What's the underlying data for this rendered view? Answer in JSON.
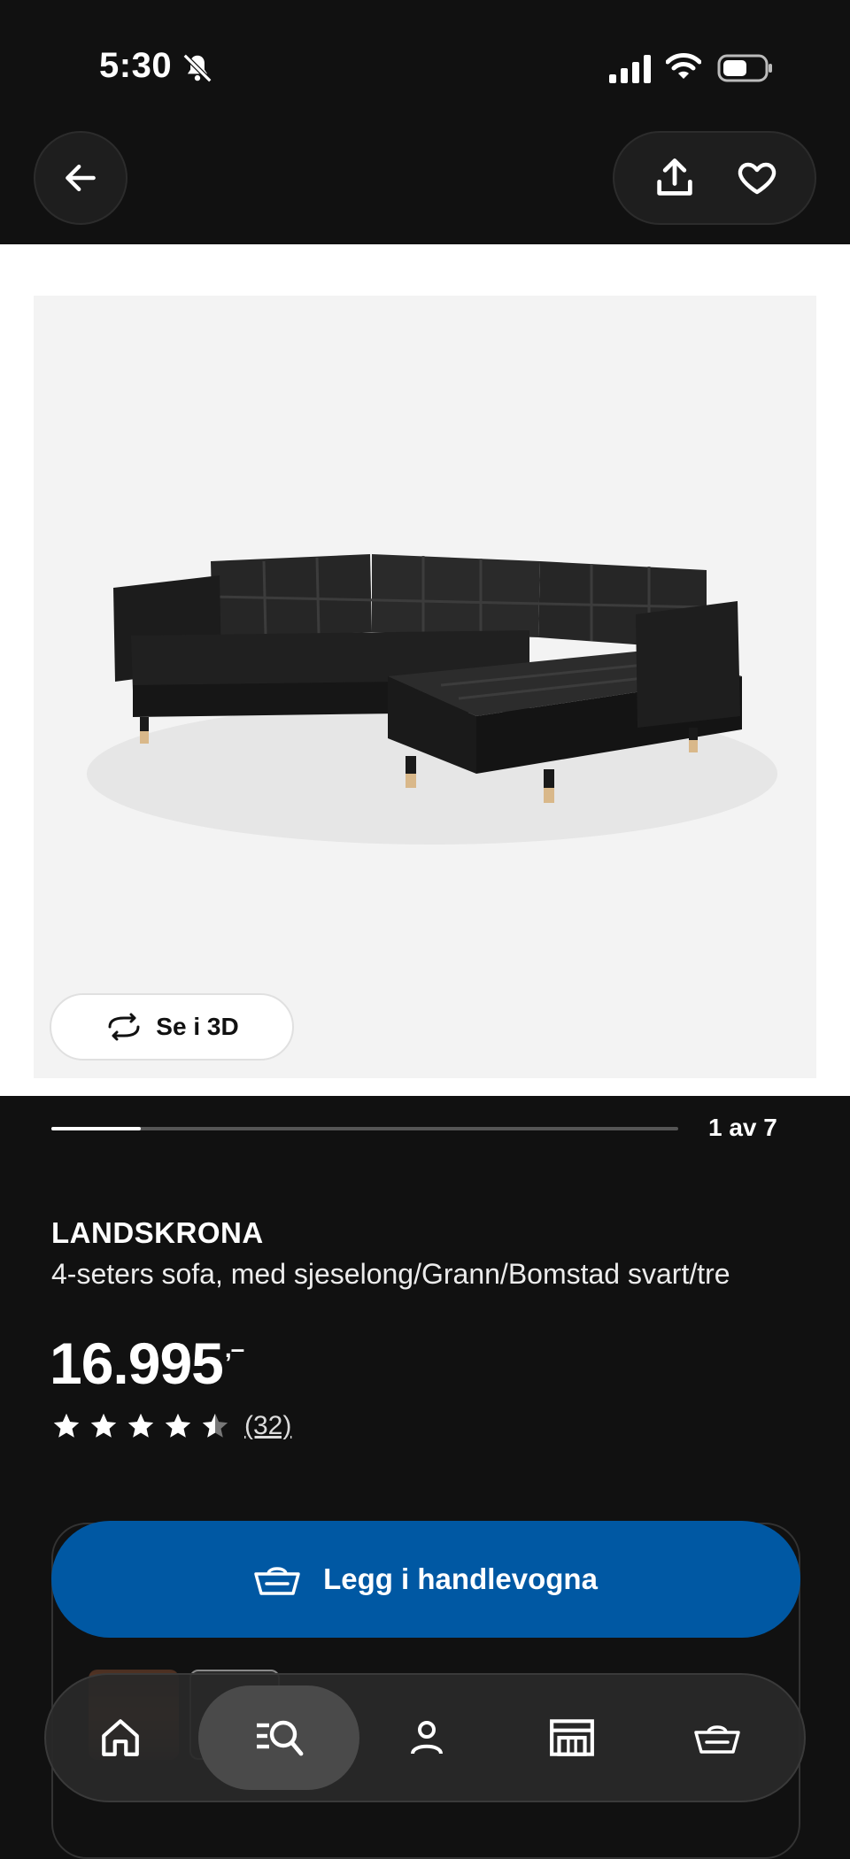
{
  "status_bar": {
    "time": "5:30"
  },
  "product": {
    "name": "LANDSKRONA",
    "description": "4-seters sofa, med sjeselong/Grann/Bomstad svart/tre",
    "price": "16.995",
    "price_suffix": ",–",
    "rating": 4.5,
    "review_count": "(32)"
  },
  "gallery": {
    "see_3d_label": "Se i 3D",
    "page_counter": "1 av 7",
    "current_page": 1,
    "total_pages": 7
  },
  "actions": {
    "add_to_cart_label": "Legg i handlevogna"
  },
  "bottom_nav": {
    "items": [
      "home-icon",
      "search-icon",
      "profile-icon",
      "store-icon",
      "cart-icon"
    ],
    "active": "search-icon"
  },
  "colors": {
    "accent": "#0058a3",
    "background": "#111111"
  }
}
